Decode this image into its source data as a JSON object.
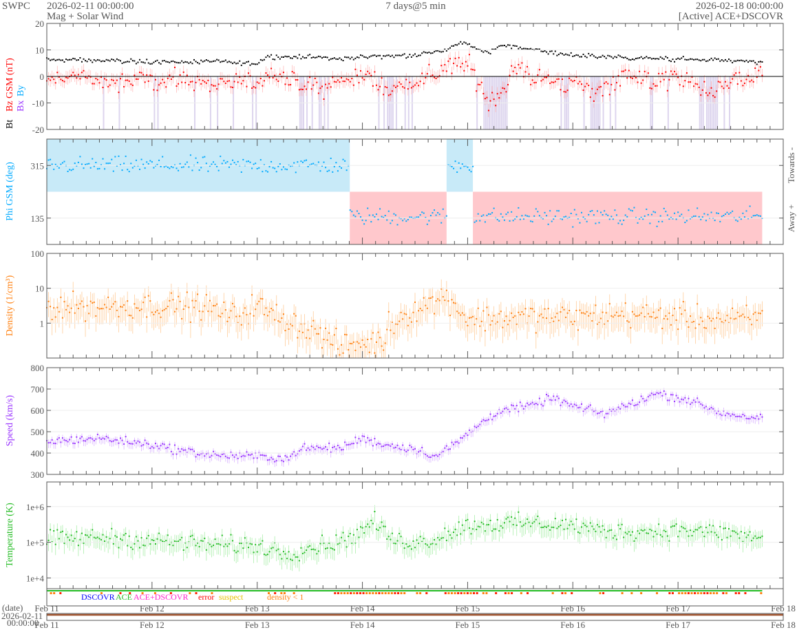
{
  "header": {
    "org": "SWPC",
    "start": "2026-02-11 00:00:00",
    "subtitle": "Mag + Solar Wind",
    "span": "7 days@5 min",
    "end": "2026-02-18 00:00:00",
    "source": "[Active] ACE+DSCOVR"
  },
  "colors": {
    "bt": "#000000",
    "bz": "#ff0000",
    "bx": "#9933ff",
    "by": "#00aaff",
    "phi": "#00aaff",
    "density": "#ff7f0e",
    "speed": "#9933ff",
    "temp": "#22bb22",
    "towards": "#c8eaf8",
    "away": "#ffc8cc",
    "neg": "#ddd5ee"
  },
  "legend": {
    "dscovr": "DSCOVR",
    "ace": "ACE",
    "both": "ACE+DSCOVR",
    "error": "error",
    "suspect": "suspect",
    "density": "density < 1"
  },
  "date_axis": {
    "label": "(date)",
    "start_date": "2026-02-11",
    "start_time": "00:00:00"
  },
  "chart_data": [
    {
      "type": "scatter",
      "title": "Bt / Bz GSM",
      "ylabel_parts": [
        "Bt",
        "Bz GSM (nT)",
        "Bx",
        "By"
      ],
      "xlabels": [
        "Feb 11",
        "Feb 12",
        "Feb 13",
        "Feb 14",
        "Feb 15",
        "Feb 16",
        "Feb 17",
        "Feb 18"
      ],
      "ylim": [
        -20,
        20
      ],
      "yticks": [
        "20",
        "10",
        "0",
        "-10",
        "-20"
      ],
      "ytick_values": [
        20,
        10,
        0,
        -10,
        -20
      ],
      "series": [
        {
          "name": "Bt",
          "anchors": [
            [
              0,
              6.3
            ],
            [
              0.5,
              6
            ],
            [
              1,
              5.5
            ],
            [
              1.5,
              5.5
            ],
            [
              2,
              5
            ],
            [
              2.1,
              7.5
            ],
            [
              2.5,
              7.5
            ],
            [
              2.8,
              6.5
            ],
            [
              3,
              7.5
            ],
            [
              3.5,
              8
            ],
            [
              3.8,
              10
            ],
            [
              3.95,
              13
            ],
            [
              4.05,
              11
            ],
            [
              4.2,
              9
            ],
            [
              4.3,
              11.5
            ],
            [
              4.5,
              11
            ],
            [
              4.8,
              9
            ],
            [
              5,
              8
            ],
            [
              5.5,
              7
            ],
            [
              6,
              6.5
            ],
            [
              6.5,
              6
            ],
            [
              6.8,
              5
            ]
          ]
        },
        {
          "name": "Bz",
          "anchors": [
            [
              0,
              -2
            ],
            [
              0.3,
              1
            ],
            [
              0.6,
              -3
            ],
            [
              1,
              -1
            ],
            [
              1.5,
              -2
            ],
            [
              2,
              -3
            ],
            [
              2.1,
              2
            ],
            [
              2.3,
              -2
            ],
            [
              2.6,
              -5
            ],
            [
              2.9,
              0
            ],
            [
              3.1,
              -1
            ],
            [
              3.25,
              -5
            ],
            [
              3.5,
              -2
            ],
            [
              3.8,
              3
            ],
            [
              4.0,
              5
            ],
            [
              4.1,
              -2
            ],
            [
              4.2,
              -10
            ],
            [
              4.3,
              -6
            ],
            [
              4.45,
              3
            ],
            [
              4.7,
              -1
            ],
            [
              5,
              -3
            ],
            [
              5.2,
              -6
            ],
            [
              5.5,
              1
            ],
            [
              5.8,
              -2
            ],
            [
              6,
              0
            ],
            [
              6.3,
              -6
            ],
            [
              6.6,
              -1
            ],
            [
              6.8,
              0
            ]
          ]
        }
      ]
    },
    {
      "type": "scatter",
      "title": "Phi GSM",
      "ylabel": "Phi GSM (deg)",
      "ylim": [
        45,
        405
      ],
      "yticks": [
        "315",
        "135"
      ],
      "ytick_values": [
        315,
        135
      ],
      "right_labels": [
        "Towards -",
        "Away +"
      ],
      "sectors": [
        [
          0,
          2.88,
          "T"
        ],
        [
          2.88,
          3.8,
          "A"
        ],
        [
          3.8,
          4.05,
          "T"
        ],
        [
          4.05,
          6.8,
          "A"
        ]
      ]
    },
    {
      "type": "scatter",
      "title": "Density",
      "ylabel": "Density (1/cm³)",
      "scale": "log",
      "ylim": [
        0.1,
        100
      ],
      "yticks": [
        "100",
        "10",
        "1"
      ],
      "ytick_values": [
        100,
        10,
        1
      ],
      "anchors": [
        [
          0,
          3
        ],
        [
          0.5,
          3
        ],
        [
          1,
          3.2
        ],
        [
          1.5,
          3
        ],
        [
          1.8,
          1.5
        ],
        [
          2.0,
          3.5
        ],
        [
          2.1,
          2
        ],
        [
          2.3,
          1.2
        ],
        [
          2.6,
          0.5
        ],
        [
          2.8,
          0.2
        ],
        [
          2.9,
          0.25
        ],
        [
          3.2,
          0.3
        ],
        [
          3.25,
          0.9
        ],
        [
          3.5,
          2.5
        ],
        [
          3.8,
          6
        ],
        [
          3.9,
          3
        ],
        [
          4.0,
          1.3
        ],
        [
          4.5,
          1.5
        ],
        [
          5,
          1.5
        ],
        [
          5.5,
          1.8
        ],
        [
          6,
          1.5
        ],
        [
          6.5,
          1.2
        ],
        [
          6.8,
          1.5
        ]
      ]
    },
    {
      "type": "scatter",
      "title": "Speed",
      "ylabel": "Speed (km/s)",
      "ylim": [
        300,
        800
      ],
      "yticks": [
        "800",
        "700",
        "600",
        "500",
        "400",
        "300"
      ],
      "ytick_values": [
        800,
        700,
        600,
        500,
        400,
        300
      ],
      "anchors": [
        [
          0,
          455
        ],
        [
          0.5,
          470
        ],
        [
          1,
          440
        ],
        [
          1.3,
          410
        ],
        [
          1.6,
          390
        ],
        [
          2,
          385
        ],
        [
          2.3,
          375
        ],
        [
          2.4,
          420
        ],
        [
          2.8,
          425
        ],
        [
          3,
          470
        ],
        [
          3.2,
          440
        ],
        [
          3.5,
          420
        ],
        [
          3.7,
          385
        ],
        [
          3.9,
          450
        ],
        [
          4.1,
          530
        ],
        [
          4.3,
          600
        ],
        [
          4.6,
          620
        ],
        [
          4.8,
          660
        ],
        [
          5,
          620
        ],
        [
          5.3,
          585
        ],
        [
          5.5,
          620
        ],
        [
          5.8,
          680
        ],
        [
          6.1,
          650
        ],
        [
          6.4,
          590
        ],
        [
          6.8,
          560
        ]
      ]
    },
    {
      "type": "scatter",
      "title": "Temperature",
      "ylabel": "Temperature (K)",
      "scale": "log",
      "ylim": [
        5000,
        4900000
      ],
      "yticks": [
        "1e+6",
        "1e+5",
        "1e+4"
      ],
      "ytick_values": [
        1000000,
        100000,
        10000
      ],
      "anchors": [
        [
          0,
          120000
        ],
        [
          0.5,
          140000
        ],
        [
          1,
          110000
        ],
        [
          1.5,
          90000
        ],
        [
          2,
          80000
        ],
        [
          2.3,
          50000
        ],
        [
          2.5,
          70000
        ],
        [
          2.8,
          110000
        ],
        [
          3,
          200000
        ],
        [
          3.1,
          400000
        ],
        [
          3.3,
          110000
        ],
        [
          3.6,
          100000
        ],
        [
          4,
          300000
        ],
        [
          4.5,
          350000
        ],
        [
          5,
          300000
        ],
        [
          5.3,
          200000
        ],
        [
          5.7,
          200000
        ],
        [
          6,
          220000
        ],
        [
          6.5,
          180000
        ],
        [
          6.8,
          120000
        ]
      ]
    }
  ]
}
